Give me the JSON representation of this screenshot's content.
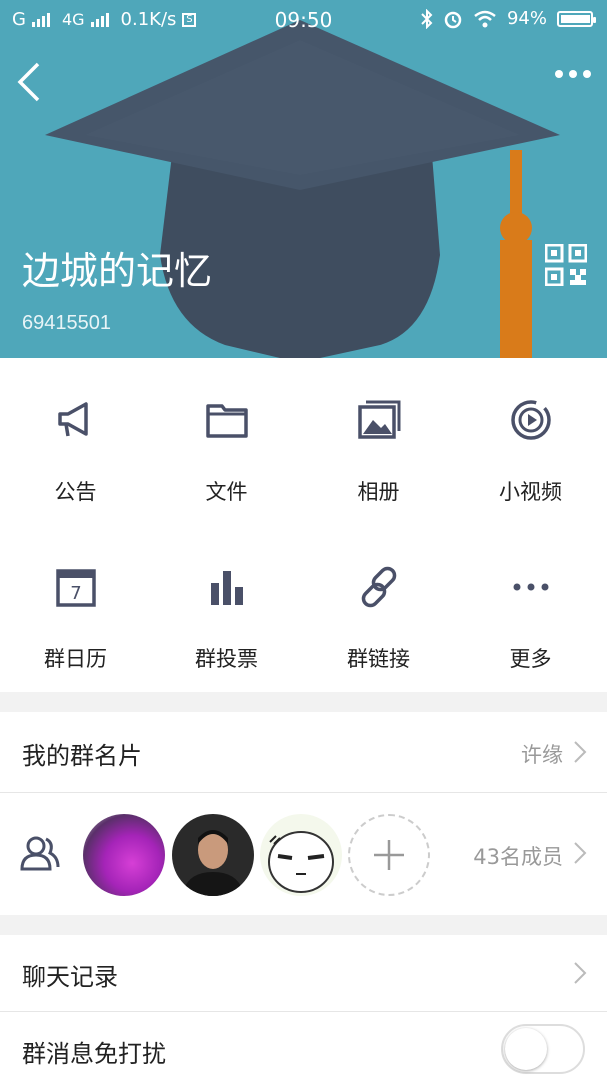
{
  "status_bar": {
    "network": "G",
    "network2": "4G",
    "speed": "0.1K/s",
    "time": "09:50",
    "battery": "94%",
    "battery_level": 0.94
  },
  "header": {
    "group_name": "边城的记忆",
    "group_id": "69415501"
  },
  "features": [
    {
      "label": "公告",
      "icon": "megaphone-icon"
    },
    {
      "label": "文件",
      "icon": "folder-icon"
    },
    {
      "label": "相册",
      "icon": "photo-album-icon"
    },
    {
      "label": "小视频",
      "icon": "video-icon"
    },
    {
      "label": "群日历",
      "icon": "calendar-icon"
    },
    {
      "label": "群投票",
      "icon": "bar-chart-icon"
    },
    {
      "label": "群链接",
      "icon": "link-icon"
    },
    {
      "label": "更多",
      "icon": "more-icon"
    }
  ],
  "calendar_day": "7",
  "my_card": {
    "title": "我的群名片",
    "value": "许缘"
  },
  "members": {
    "count_label": "43名成员"
  },
  "chat_history": {
    "title": "聊天记录"
  },
  "do_not_disturb": {
    "title": "群消息免打扰",
    "enabled": false
  },
  "colors": {
    "header_bg": "#4fa7ba",
    "icon": "#4a5068",
    "tassel": "#d97b1a"
  }
}
